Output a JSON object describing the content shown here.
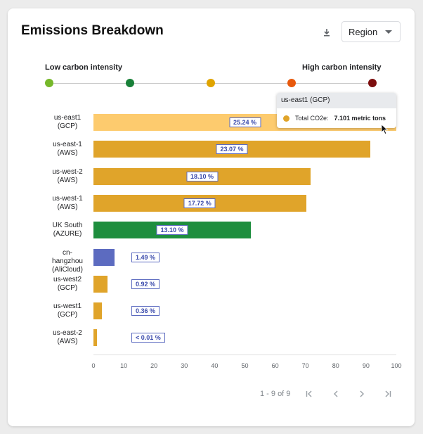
{
  "card": {
    "title": "Emissions Breakdown",
    "download_icon": "download-icon",
    "region_select": {
      "value": "Region"
    }
  },
  "scale": {
    "low_label": "Low carbon intensity",
    "high_label": "High carbon intensity",
    "levels": [
      "#76b82a",
      "#188038",
      "#e0a400",
      "#e8590c",
      "#7d0f0f"
    ]
  },
  "chart_data": {
    "type": "bar",
    "orientation": "horizontal",
    "categories": [
      [
        "us-east1",
        "(GCP)"
      ],
      [
        "us-east-1",
        "(AWS)"
      ],
      [
        "us-west-2",
        "(AWS)"
      ],
      [
        "us-west-1",
        "(AWS)"
      ],
      [
        "UK South",
        "(AZURE)"
      ],
      [
        "cn-hangzhou",
        "(AliCloud)"
      ],
      [
        "us-west2",
        "(GCP)"
      ],
      [
        "us-west1",
        "(GCP)"
      ],
      [
        "us-east-2",
        "(AWS)"
      ]
    ],
    "values": [
      100,
      91.4,
      71.7,
      70.2,
      52,
      6.9,
      4.6,
      2.7,
      1.2
    ],
    "data_labels": [
      "25.24 %",
      "23.07 %",
      "18.10 %",
      "17.72 %",
      "13.10 %",
      "1.49 %",
      "0.92 %",
      "0.36 %",
      "< 0.01 %"
    ],
    "colors": [
      "#fdcb6e",
      "#e0a42a",
      "#e0a42a",
      "#e0a42a",
      "#1e8e3e",
      "#5c6bc0",
      "#e0a42a",
      "#e0a42a",
      "#e0a42a"
    ],
    "xlim": [
      0,
      100
    ],
    "xticks": [
      0,
      10,
      20,
      30,
      40,
      50,
      60,
      70,
      80,
      90,
      100
    ],
    "grid": false,
    "legend": "none"
  },
  "tooltip": {
    "title": "us-east1 (GCP)",
    "metric_label": "Total CO2e:",
    "metric_value": "7.101 metric tons",
    "dot_color": "#e0a42a"
  },
  "pagination": {
    "range": "1 - 9 of 9",
    "icons": [
      "first-page-icon",
      "previous-page-icon",
      "next-page-icon",
      "last-page-icon"
    ]
  }
}
